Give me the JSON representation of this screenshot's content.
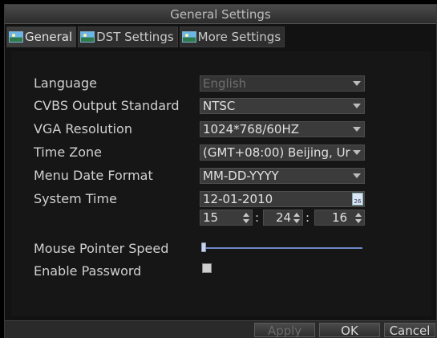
{
  "window": {
    "title": "General Settings"
  },
  "tabs": [
    {
      "label": "General",
      "active": true,
      "icon": "landscape-icon"
    },
    {
      "label": "DST Settings",
      "active": false,
      "icon": "landscape-icon"
    },
    {
      "label": "More Settings",
      "active": false,
      "icon": "landscape-icon"
    }
  ],
  "settings": {
    "language": {
      "label": "Language",
      "value": "English",
      "enabled": false
    },
    "cvbs": {
      "label": "CVBS Output Standard",
      "value": "NTSC"
    },
    "vga": {
      "label": "VGA Resolution",
      "value": "1024*768/60HZ"
    },
    "timezone": {
      "label": "Time Zone",
      "value": "(GMT+08:00) Beijing, Ur"
    },
    "date_format": {
      "label": "Menu Date Format",
      "value": "MM-DD-YYYY"
    },
    "system_time": {
      "label": "System Time",
      "date": "12-01-2010",
      "calendar_day": "26",
      "hour": "15",
      "minute": "24",
      "second": "16",
      "separator": ":"
    },
    "mouse_speed": {
      "label": "Mouse Pointer Speed",
      "level": 0.0
    },
    "enable_password": {
      "label": "Enable Password",
      "checked": false
    }
  },
  "buttons": {
    "apply": "Apply",
    "ok": "OK",
    "cancel": "Cancel"
  },
  "colors": {
    "slider": "#6b88c8",
    "background": "#121212"
  }
}
